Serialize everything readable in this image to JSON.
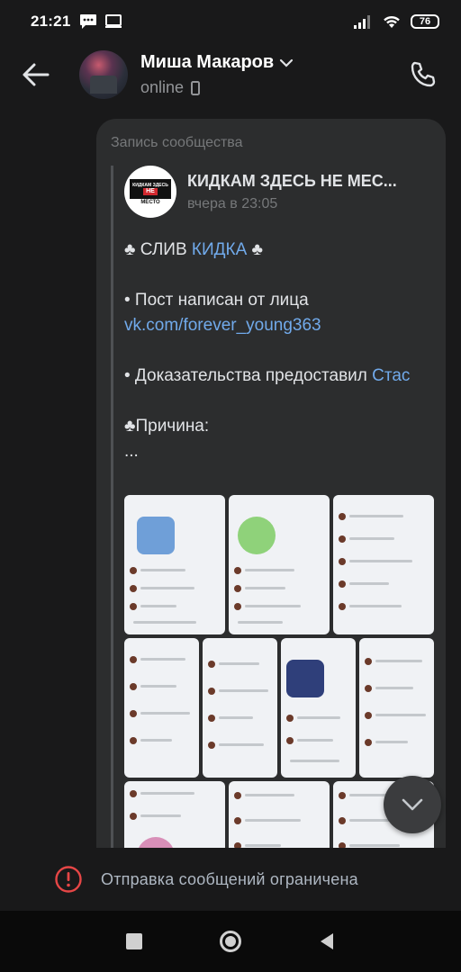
{
  "status_bar": {
    "time": "21:21",
    "battery": "76"
  },
  "header": {
    "name": "Миша Макаров",
    "status": "online"
  },
  "message": {
    "repost_label": "Запись сообщества",
    "group_name": "КИДКАМ ЗДЕСЬ НЕ МЕС...",
    "logo_top": "КИДКАМ ЗДЕСЬ",
    "logo_middle": "НЕ",
    "logo_bottom": "МЕСТО",
    "time": "вчера в 23:05",
    "line1_prefix": "♣ СЛИВ ",
    "line1_link": "КИДКА",
    "line1_suffix": " ♣",
    "line2_prefix": "• Пост написан от лица ",
    "line2_link": "vk.com/forever_young363",
    "line3_prefix": "• Доказательства предоставил ",
    "line3_link": "Стас",
    "line4": "♣Причина:",
    "line5": "..."
  },
  "restriction": {
    "text": "Отправка сообщений ограничена"
  },
  "colors": {
    "accent": "#71aaeb",
    "warning": "#e64646",
    "background": "#19191a",
    "bubble": "#2c2d2e"
  }
}
